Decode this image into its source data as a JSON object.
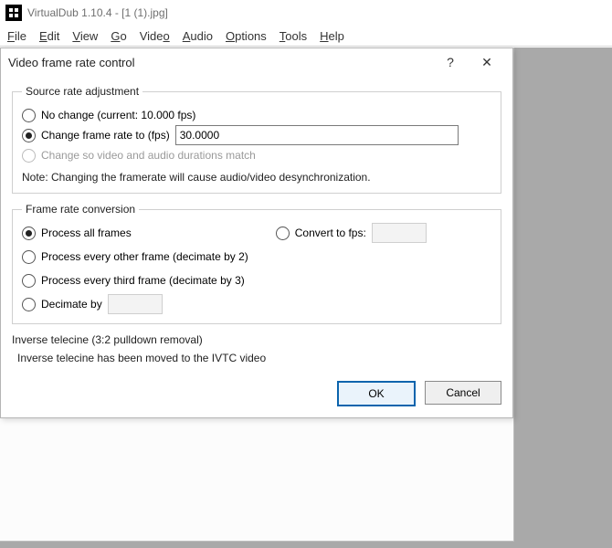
{
  "app": {
    "title": "VirtualDub 1.10.4 - [1 (1).jpg]"
  },
  "menu": {
    "file": "File",
    "edit": "Edit",
    "view": "View",
    "go": "Go",
    "video": "Video",
    "audio": "Audio",
    "options": "Options",
    "tools": "Tools",
    "help": "Help"
  },
  "dialog": {
    "title": "Video frame rate control",
    "help_symbol": "?",
    "close_symbol": "✕",
    "source_rate": {
      "legend": "Source rate adjustment",
      "no_change": "No change (current: 10.000 fps)",
      "change_to": "Change frame rate to (fps)",
      "change_to_value": "30.0000",
      "match_av": "Change so video and audio durations match",
      "note": "Note: Changing the framerate will cause audio/video desynchronization."
    },
    "frc": {
      "legend": "Frame rate conversion",
      "process_all": "Process all frames",
      "decimate2": "Process every other frame (decimate by 2)",
      "decimate3": "Process every third frame (decimate by 3)",
      "decimate_by": "Decimate by",
      "decimate_by_value": "",
      "convert_to_fps": "Convert to fps:",
      "convert_to_fps_value": ""
    },
    "ivtc": {
      "header": "Inverse telecine (3:2 pulldown removal)",
      "body": "Inverse telecine has been moved to the IVTC video"
    },
    "buttons": {
      "ok": "OK",
      "cancel": "Cancel"
    }
  }
}
